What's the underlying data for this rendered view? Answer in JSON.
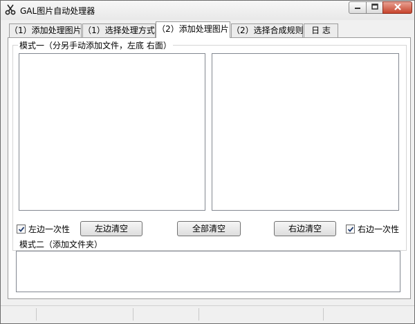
{
  "window": {
    "title": "GAL图片自动处理器"
  },
  "tabs": [
    {
      "label": "（1）添加处理图片"
    },
    {
      "label": "（1）选择处理方式"
    },
    {
      "label": "（2）添加处理图片"
    },
    {
      "label": "（2）选择合成规则"
    },
    {
      "label": "日 志"
    }
  ],
  "mode1": {
    "title": "模式一（分另手动添加文件，左底 右面）",
    "left_checkbox": {
      "label": "左边一次性",
      "checked": true
    },
    "right_checkbox": {
      "label": "右边一次性",
      "checked": true
    },
    "buttons": {
      "clear_left": "左边清空",
      "clear_all": "全部清空",
      "clear_right": "右边清空"
    }
  },
  "mode2": {
    "title": "模式二（添加文件夹）"
  },
  "icons": {
    "app": "scissors-icon",
    "minimize": "minimize-icon",
    "maximize": "maximize-icon",
    "close": "close-icon"
  }
}
